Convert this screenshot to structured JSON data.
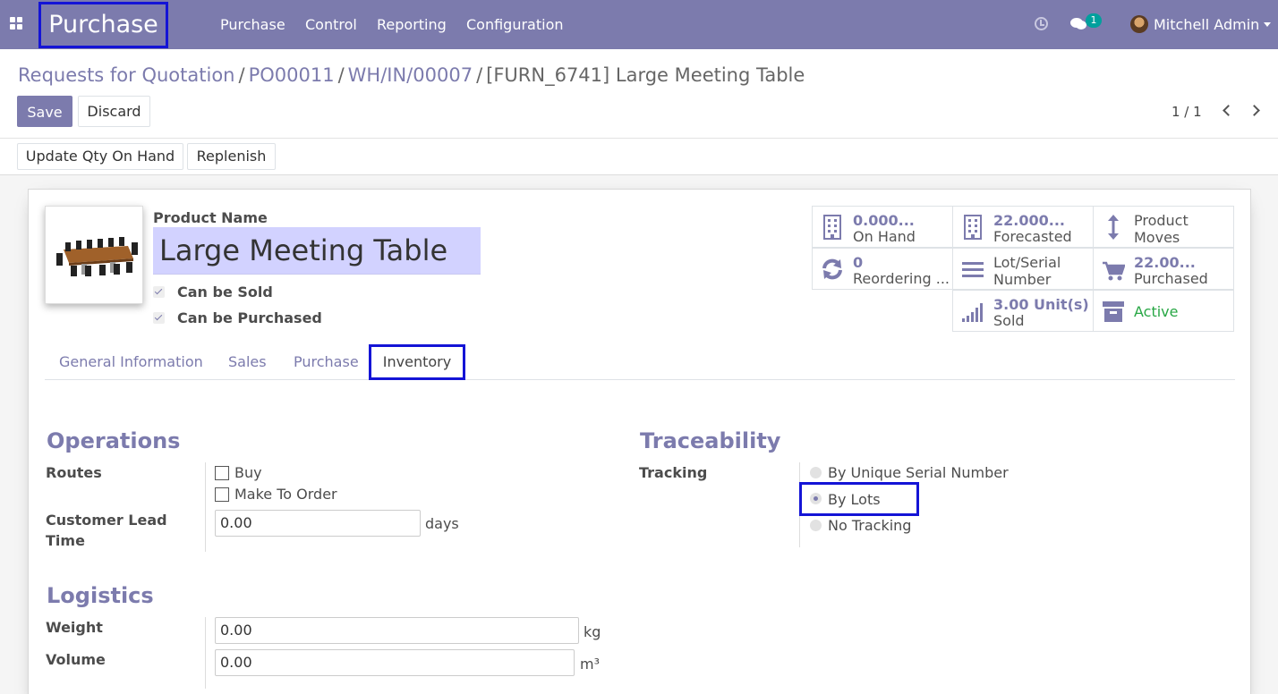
{
  "navbar": {
    "app_name": "Purchase",
    "menu": [
      "Purchase",
      "Control",
      "Reporting",
      "Configuration"
    ],
    "chat_badge": "1",
    "user_name": "Mitchell Admin",
    "bg_color": "#7c7bad"
  },
  "breadcrumb": {
    "items": [
      "Requests for Quotation",
      "PO00011",
      "WH/IN/00007"
    ],
    "separator": "/",
    "current": "[FURN_6741] Large Meeting Table"
  },
  "control": {
    "save_label": "Save",
    "discard_label": "Discard",
    "pager": "1 / 1"
  },
  "actions": {
    "update_qty": "Update Qty On Hand",
    "replenish": "Replenish"
  },
  "product": {
    "name_label": "Product Name",
    "name": "Large Meeting Table",
    "can_be_sold": "Can be Sold",
    "can_be_purchased": "Can be Purchased"
  },
  "stats": {
    "on_hand": {
      "value": "0.000...",
      "label": "On Hand",
      "icon": "building-icon"
    },
    "forecasted": {
      "value": "22.000...",
      "label": "Forecasted",
      "icon": "building-icon"
    },
    "moves": {
      "label": "Product\nMoves",
      "icon": "arrows-v-icon"
    },
    "reordering": {
      "value": "0",
      "label": "Reordering ...",
      "icon": "refresh-icon"
    },
    "lot_serial": {
      "label": "Lot/Serial\nNumber",
      "icon": "bars-icon"
    },
    "purchased": {
      "value": "22.00...",
      "label": "Purchased",
      "icon": "cart-icon"
    },
    "sold": {
      "value": "3.00 Unit(s)",
      "label": "Sold",
      "icon": "signal-icon"
    },
    "archive": {
      "label": "Active",
      "icon": "archive-icon",
      "color": "#28a745"
    }
  },
  "tabs": {
    "general": "General Information",
    "sales": "Sales",
    "purchase": "Purchase",
    "inventory": "Inventory"
  },
  "operations": {
    "title": "Operations",
    "routes_label": "Routes",
    "route_buy": "Buy",
    "route_mto": "Make To Order",
    "lead_time_label": "Customer Lead Time",
    "lead_time_value": "0.00",
    "lead_time_unit": "days"
  },
  "traceability": {
    "title": "Traceability",
    "tracking_label": "Tracking",
    "options": [
      "By Unique Serial Number",
      "By Lots",
      "No Tracking"
    ],
    "selected": "By Lots"
  },
  "logistics": {
    "title": "Logistics",
    "weight_label": "Weight",
    "weight_value": "0.00",
    "weight_unit": "kg",
    "volume_label": "Volume",
    "volume_value": "0.00",
    "volume_unit": "m³"
  }
}
